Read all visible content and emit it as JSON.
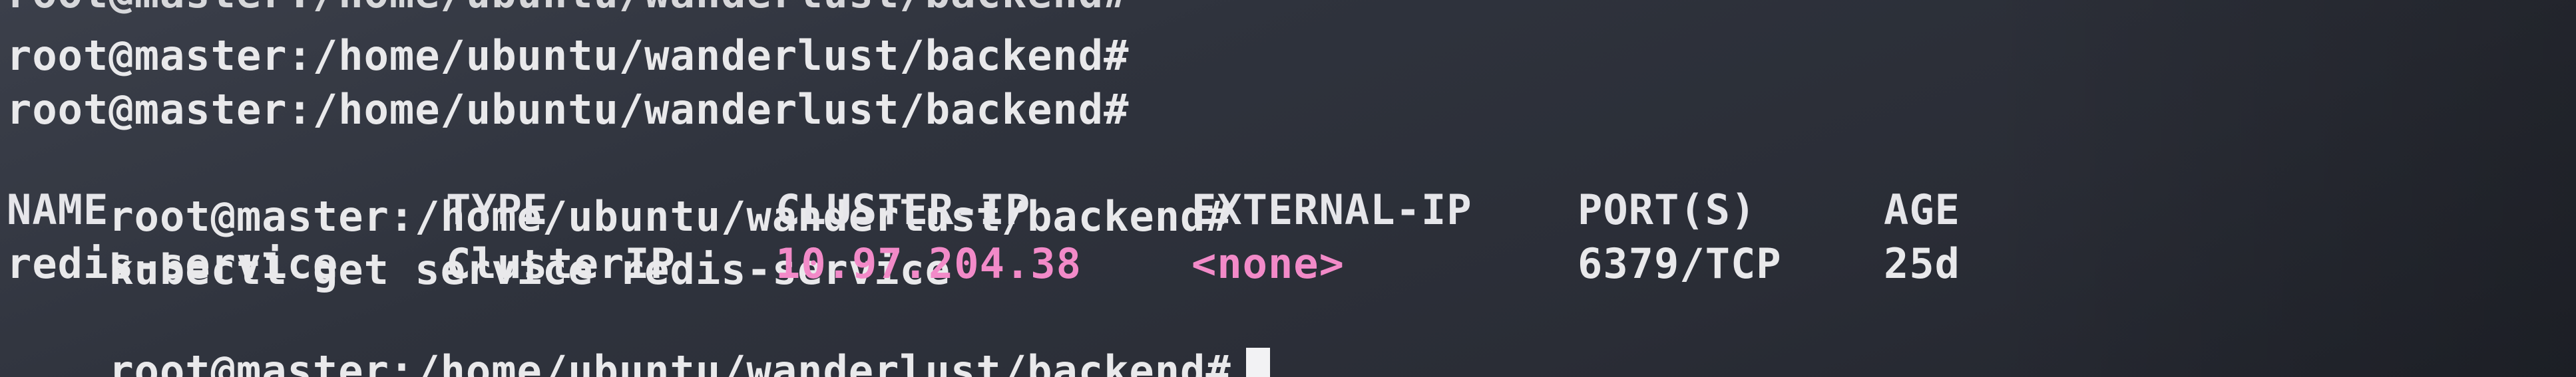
{
  "terminal": {
    "lines": {
      "partial_top": "root@master:/home/ubuntu/wanderlust/backend#",
      "prompt1": "root@master:/home/ubuntu/wanderlust/backend#",
      "prompt2": "root@master:/home/ubuntu/wanderlust/backend#",
      "command_prompt": "root@master:/home/ubuntu/wanderlust/backend#",
      "command": "kubectl get service redis-service",
      "final_prompt": "root@master:/home/ubuntu/wanderlust/backend#"
    },
    "table": {
      "headers": {
        "name": "NAME",
        "type": "TYPE",
        "cluster_ip": "CLUSTER-IP",
        "external_ip": "EXTERNAL-IP",
        "ports": "PORT(S)",
        "age": "AGE"
      },
      "row": {
        "name": "redis-service",
        "type": "ClusterIP",
        "cluster_ip": "10.97.204.38",
        "external_ip": "<none>",
        "ports": "6379/TCP",
        "age": "25d"
      }
    },
    "colors": {
      "background": "#2f333d",
      "text": "#e9e9eb",
      "highlight": "#f28ac8"
    }
  }
}
